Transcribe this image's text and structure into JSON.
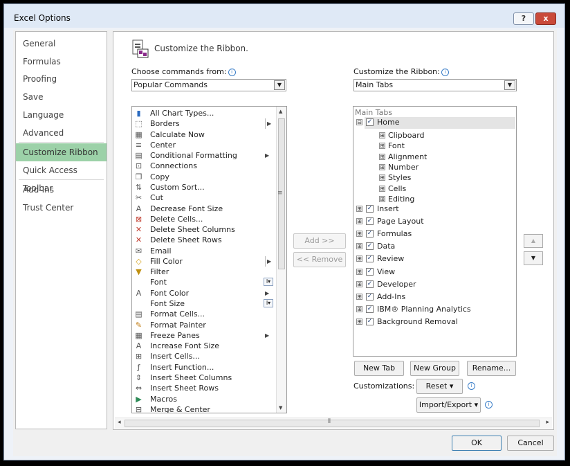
{
  "window": {
    "title": "Excel Options"
  },
  "title_buttons": {
    "help": "?",
    "close": "x"
  },
  "nav": {
    "items": [
      "General",
      "Formulas",
      "Proofing",
      "Save",
      "Language",
      "Advanced",
      "Customize Ribbon",
      "Quick Access Toolbar",
      "Add-Ins",
      "Trust Center"
    ],
    "selected": "Customize Ribbon"
  },
  "page": {
    "heading": "Customize the Ribbon.",
    "choose_label": "Choose commands from:",
    "choose_value": "Popular Commands",
    "customize_label": "Customize the Ribbon:",
    "customize_value": "Main Tabs"
  },
  "commands": [
    {
      "label": "All Chart Types...",
      "icon": "chart-icon"
    },
    {
      "label": "Borders",
      "icon": "borders-icon",
      "sub": "split-arrow"
    },
    {
      "label": "Calculate Now",
      "icon": "calculator-icon"
    },
    {
      "label": "Center",
      "icon": "align-center-icon"
    },
    {
      "label": "Conditional Formatting",
      "icon": "conditional-formatting-icon",
      "sub": "arrow"
    },
    {
      "label": "Connections",
      "icon": "connections-icon"
    },
    {
      "label": "Copy",
      "icon": "copy-icon"
    },
    {
      "label": "Custom Sort...",
      "icon": "sort-icon"
    },
    {
      "label": "Cut",
      "icon": "scissors-icon"
    },
    {
      "label": "Decrease Font Size",
      "icon": "decrease-font-icon"
    },
    {
      "label": "Delete Cells...",
      "icon": "delete-cells-icon"
    },
    {
      "label": "Delete Sheet Columns",
      "icon": "delete-columns-icon"
    },
    {
      "label": "Delete Sheet Rows",
      "icon": "delete-rows-icon"
    },
    {
      "label": "Email",
      "icon": "email-icon"
    },
    {
      "label": "Fill Color",
      "icon": "fill-color-icon",
      "sub": "split-arrow"
    },
    {
      "label": "Filter",
      "icon": "filter-icon"
    },
    {
      "label": "Font",
      "icon": "",
      "sub": "box"
    },
    {
      "label": "Font Color",
      "icon": "font-color-icon",
      "sub": "arrow"
    },
    {
      "label": "Font Size",
      "icon": "",
      "sub": "box"
    },
    {
      "label": "Format Cells...",
      "icon": "format-cells-icon"
    },
    {
      "label": "Format Painter",
      "icon": "format-painter-icon"
    },
    {
      "label": "Freeze Panes",
      "icon": "freeze-panes-icon",
      "sub": "arrow"
    },
    {
      "label": "Increase Font Size",
      "icon": "increase-font-icon"
    },
    {
      "label": "Insert Cells...",
      "icon": "insert-cells-icon"
    },
    {
      "label": "Insert Function...",
      "icon": "function-icon"
    },
    {
      "label": "Insert Sheet Columns",
      "icon": "insert-columns-icon"
    },
    {
      "label": "Insert Sheet Rows",
      "icon": "insert-rows-icon"
    },
    {
      "label": "Macros",
      "icon": "macros-icon"
    },
    {
      "label": "Merge & Center",
      "icon": "merge-icon"
    }
  ],
  "transfer": {
    "add": "Add >>",
    "remove": "<< Remove"
  },
  "ribbon_tree": {
    "header": "Main Tabs",
    "home": {
      "label": "Home",
      "groups": [
        "Clipboard",
        "Font",
        "Alignment",
        "Number",
        "Styles",
        "Cells",
        "Editing"
      ]
    },
    "tabs": [
      "Insert",
      "Page Layout",
      "Formulas",
      "Data",
      "Review",
      "View",
      "Developer",
      "Add-Ins",
      "IBM® Planning Analytics",
      "Background Removal"
    ]
  },
  "tree_buttons": {
    "new_tab": "New Tab",
    "new_group": "New Group",
    "rename": "Rename..."
  },
  "customizations": {
    "label": "Customizations:",
    "reset": "Reset ▾",
    "import_export": "Import/Export ▾"
  },
  "footer": {
    "ok": "OK",
    "cancel": "Cancel"
  },
  "glyphs": {
    "expand_minus": "⊟",
    "expand_plus": "⊞",
    "check": "✓",
    "up": "▲",
    "down": "▼",
    "left": "◂",
    "right": "▸",
    "grip": "≡",
    "hgrip": "⦀"
  }
}
